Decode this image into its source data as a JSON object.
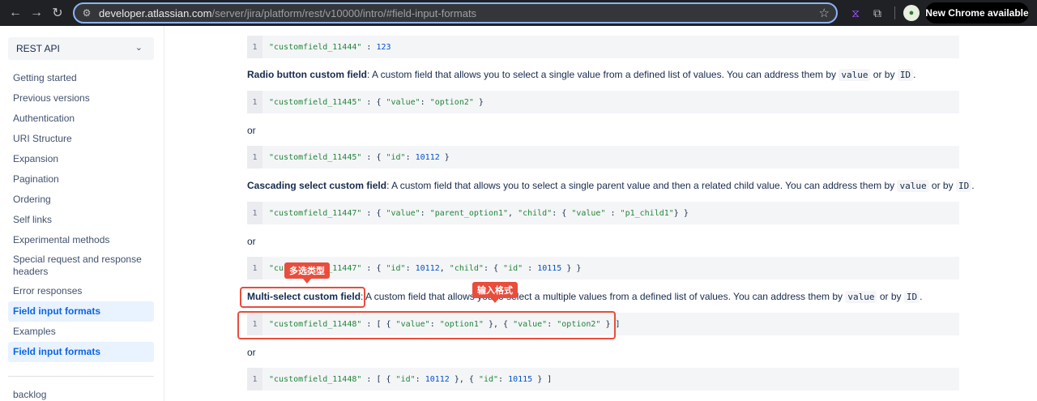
{
  "browser": {
    "back_icon": "←",
    "forward_icon": "→",
    "reload_icon": "↻",
    "url_host": "developer.atlassian.com",
    "url_path": "/server/jira/platform/rest/v10000/intro/#field-input-formats",
    "new_chrome_label": "New Chrome available",
    "accent": "#8ab4f8"
  },
  "sidebar": {
    "api_select": "REST API",
    "items": [
      {
        "label": "Getting started"
      },
      {
        "label": "Previous versions"
      },
      {
        "label": "Authentication"
      },
      {
        "label": "URI Structure"
      },
      {
        "label": "Expansion"
      },
      {
        "label": "Pagination"
      },
      {
        "label": "Ordering"
      },
      {
        "label": "Self links"
      },
      {
        "label": "Experimental methods"
      },
      {
        "label": "Special request and response headers"
      },
      {
        "label": "Error responses"
      },
      {
        "label": "Field input formats"
      },
      {
        "label": "Examples"
      },
      {
        "label": "Field input formats"
      }
    ],
    "footer_item": "backlog"
  },
  "content": {
    "code1": "\"customfield_11444\" : 123",
    "radio_title": "Radio button custom field",
    "radio_desc": ": A custom field that allows you to select a single value from a defined list of values. You can address them by ",
    "code2": "\"customfield_11445\" : { \"value\": \"option2\" }",
    "or_label": "or",
    "code3": "\"customfield_11445\" : { \"id\": 10112 }",
    "cascading_title": "Cascading select custom field",
    "cascading_desc": ": A custom field that allows you to select a single parent value and then a related child value. You can address them by ",
    "code4": "\"customfield_11447\" : { \"value\": \"parent_option1\", \"child\": { \"value\" : \"p1_child1\"} }",
    "code5": "\"customfield_11447\" : { \"id\": 10112, \"child\": { \"id\" : 10115 } }",
    "multi_title": "Multi-select custom field",
    "multi_desc": ": A custom field that allows you to select a multiple values from a defined list of values. You can address them by ",
    "code6": "\"customfield_11448\" : [ { \"value\": \"option1\" }, { \"value\": \"option2\" } ]",
    "code7": "\"customfield_11448\" : [ { \"id\": 10112 }, { \"id\": 10115 } ]",
    "inline_value": "value",
    "inline_or_by": " or by ",
    "inline_id": "ID",
    "period": "."
  },
  "annotations": {
    "tag_multiselect": "多选类型",
    "tag_input_format": "输入格式",
    "color": "#e94d3c"
  }
}
